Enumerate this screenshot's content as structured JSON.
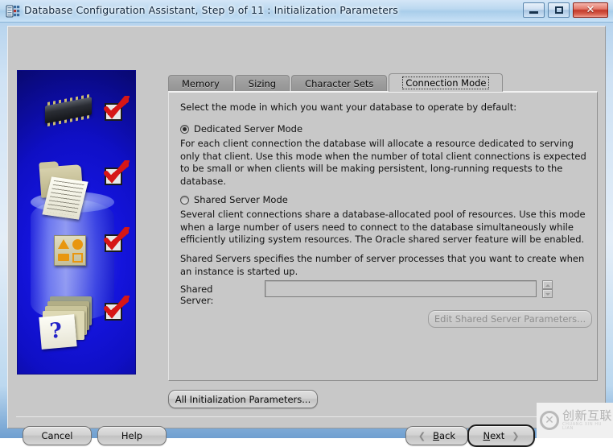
{
  "window": {
    "title": "Database Configuration Assistant, Step 9 of 11 : Initialization Parameters",
    "icon": "database-chip-icon",
    "controls": {
      "minimize": "minimize-button",
      "maximize": "maximize-button",
      "close_glyph": "✕"
    }
  },
  "tabs": [
    {
      "label": "Memory",
      "selected": false
    },
    {
      "label": "Sizing",
      "selected": false
    },
    {
      "label": "Character Sets",
      "selected": false
    },
    {
      "label": "Connection Mode",
      "selected": true
    }
  ],
  "panel": {
    "intro": "Select the mode in which you want your database to operate by default:",
    "options": [
      {
        "label": "Dedicated Server Mode",
        "selected": true,
        "description": "For each client connection the database will allocate a resource dedicated to serving only that client.  Use this mode when the number of total client connections is expected to be small or when clients will be making persistent, long-running requests to the database."
      },
      {
        "label": "Shared Server Mode",
        "selected": false,
        "description": "Several client connections share a database-allocated pool of resources.  Use this mode when a large number of users need to connect to the database simultaneously while efficiently utilizing system resources.  The Oracle shared server feature will be enabled."
      }
    ],
    "note": "Shared Servers specifies the number of server processes that you want to create when an instance is started up.",
    "field": {
      "label": "Shared Server:",
      "value": "",
      "placeholder": "",
      "spinner": {
        "up": "▲",
        "down": "▼"
      }
    },
    "edit_shared_button": {
      "label": "Edit Shared Server Parameters...",
      "enabled": false
    }
  },
  "footer": {
    "all_params_button": "All Initialization Parameters...",
    "cancel_button": "Cancel",
    "help_button": "Help",
    "back_button": {
      "prefix": "",
      "mnemonic": "B",
      "rest": "ack",
      "chevron": "❮"
    },
    "next_button": {
      "prefix": "",
      "mnemonic": "N",
      "rest": "ext",
      "chevron": "❯"
    }
  },
  "sidebar": {
    "name": "configuration-illustration",
    "question_glyph": "?",
    "steps_completed": 4
  },
  "watermark": {
    "cn": "创新互联",
    "en": "CHUANG XIN HU LIAN"
  },
  "colors": {
    "dialog_bg": "#c8c8c8",
    "titlebar": "#bcd9f0",
    "close_button": "#c2392a",
    "check_red": "#d61616",
    "sidebar_blue": "#1414dc"
  }
}
